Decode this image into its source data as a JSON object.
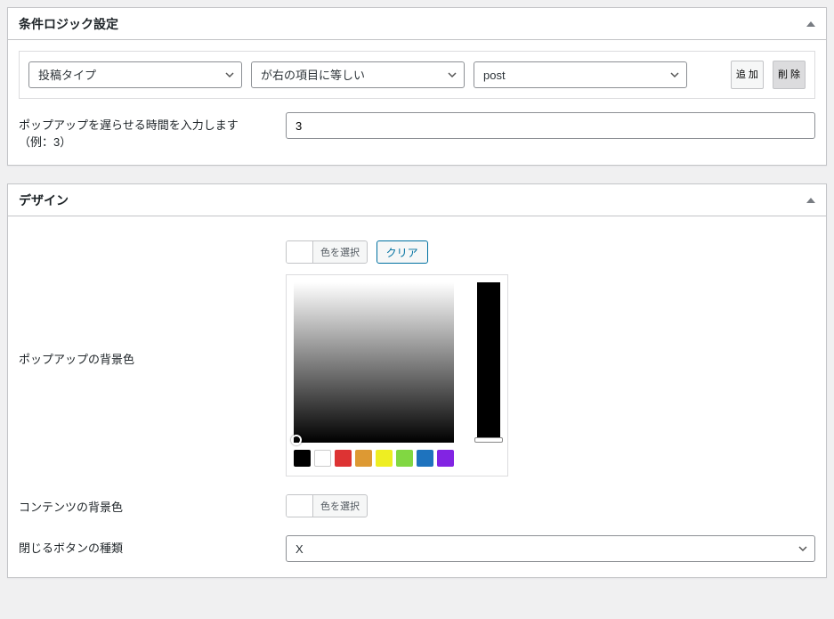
{
  "box1": {
    "title": "条件ロジック設定",
    "logic": {
      "field": "投稿タイプ",
      "operator": "が右の項目に等しい",
      "value": "post",
      "add_btn": "追\n加",
      "del_btn": "削\n除"
    },
    "delay": {
      "label": "ポップアップを遅らせる時間を入力します（例：3）",
      "value": "3"
    }
  },
  "box2": {
    "title": "デザイン",
    "popup_bg": {
      "label": "ポップアップの背景色",
      "select_btn": "色を選択",
      "clear_btn": "クリア"
    },
    "palette": [
      {
        "c": "#000000",
        "b": false
      },
      {
        "c": "#ffffff",
        "b": true
      },
      {
        "c": "#dd3333",
        "b": false
      },
      {
        "c": "#dd9933",
        "b": false
      },
      {
        "c": "#eeee22",
        "b": false
      },
      {
        "c": "#81d742",
        "b": false
      },
      {
        "c": "#1e73be",
        "b": false
      },
      {
        "c": "#8224e3",
        "b": false
      }
    ],
    "content_bg": {
      "label": "コンテンツの背景色",
      "select_btn": "色を選択"
    },
    "close_btn": {
      "label": "閉じるボタンの種類",
      "value": "X"
    }
  }
}
